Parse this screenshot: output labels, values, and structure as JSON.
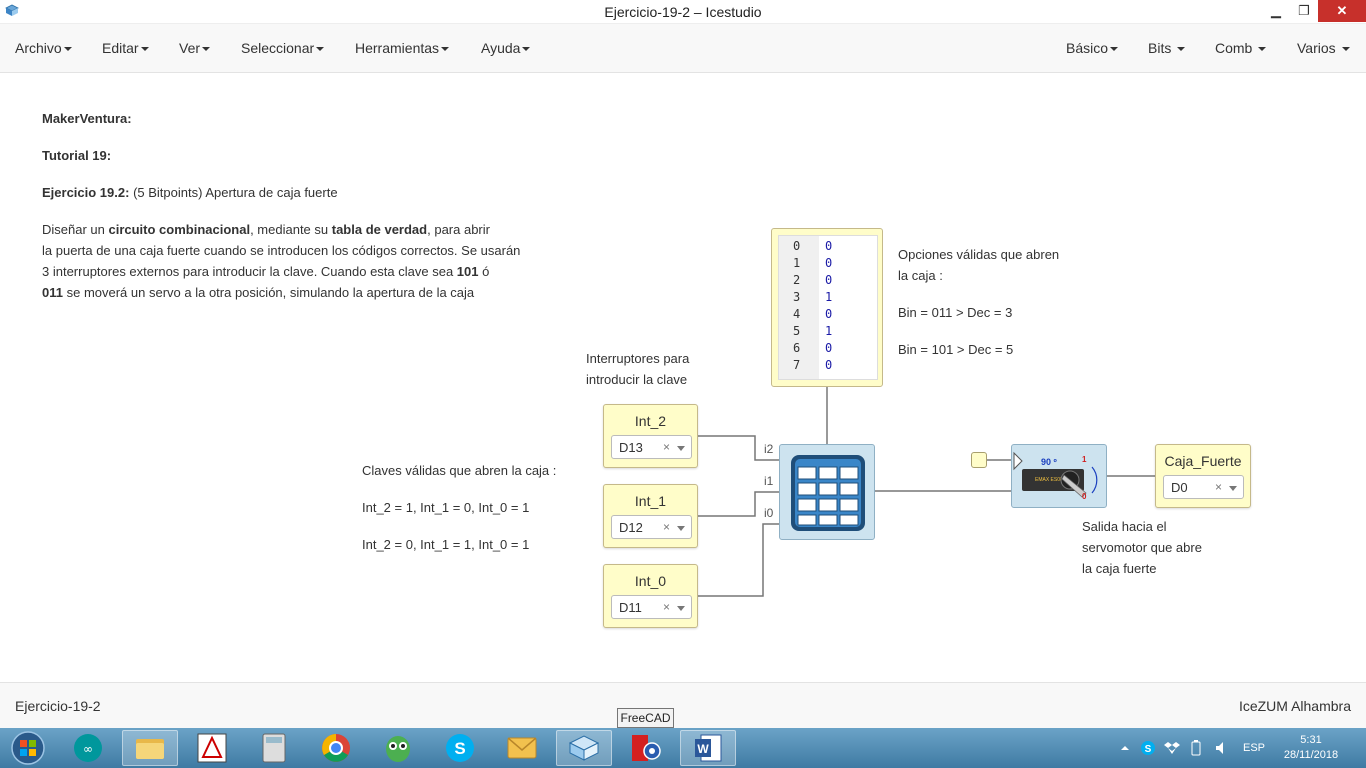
{
  "window": {
    "title": "Ejercicio-19-2 – Icestudio",
    "minimize": "▁",
    "maximize": "❐",
    "close": "✕"
  },
  "menu": {
    "left": [
      "Archivo",
      "Editar",
      "Ver",
      "Seleccionar",
      "Herramientas",
      "Ayuda"
    ],
    "right": [
      "Básico",
      "Bits",
      "Comb",
      "Varios"
    ]
  },
  "notes": {
    "header1": "MakerVentura:",
    "header2": "Tutorial 19:",
    "exercise_label": "Ejercicio 19.2:",
    "exercise_text": " (5 Bitpoints) Apertura de caja fuerte",
    "desc_line1_a": "Diseñar un ",
    "desc_line1_b": "circuito combinacional",
    "desc_line1_c": ", mediante su ",
    "desc_line1_d": "tabla de verdad",
    "desc_line1_e": ", para abrir",
    "desc_line2": "la puerta de una caja fuerte cuando se introducen los códigos correctos. Se usarán",
    "desc_line3_a": "3 interruptores externos para introducir la clave. Cuando esta clave sea ",
    "desc_line3_b": "101",
    "desc_line3_c": " ó",
    "desc_line4_a": "011",
    "desc_line4_b": " se moverá un servo a la otra posición, simulando la apertura de la caja",
    "switches_line1": "Interruptores para",
    "switches_line2": "introducir la clave",
    "keys_title": "Claves válidas que abren la caja :",
    "key1": "Int_2 = 1, Int_1 = 0, Int_0 = 1",
    "key2": "Int_2 = 0, Int_1 = 1, Int_0 = 1",
    "options_line1": "Opciones válidas que abren",
    "options_line2": "la caja :",
    "option1": "Bin = 011 > Dec = 3",
    "option2": "Bin = 101 > Dec = 5",
    "output_line1": "Salida hacia el",
    "output_line2": "servomotor que abre",
    "output_line3": "la caja fuerte"
  },
  "inputs": [
    {
      "name": "Int_2",
      "pin": "D13"
    },
    {
      "name": "Int_1",
      "pin": "D12"
    },
    {
      "name": "Int_0",
      "pin": "D11"
    }
  ],
  "output": {
    "name": "Caja_Fuerte",
    "pin": "D0"
  },
  "clear_symbol": "×",
  "lut_ports": [
    "i2",
    "i1",
    "i0"
  ],
  "truth_table": {
    "indices": [
      "0",
      "1",
      "2",
      "3",
      "4",
      "5",
      "6",
      "7"
    ],
    "values": [
      "0",
      "0",
      "0",
      "1",
      "0",
      "1",
      "0",
      "0"
    ]
  },
  "servo": {
    "angle": "90 º",
    "hi": "1",
    "lo": "0",
    "brand": "EMAX ES08A"
  },
  "status": {
    "left": "Ejercicio-19-2",
    "right": "IceZUM Alhambra"
  },
  "taskbar": {
    "tooltip": "FreeCAD",
    "lang": "ESP",
    "time": "5:31",
    "date": "28/11/2018"
  }
}
